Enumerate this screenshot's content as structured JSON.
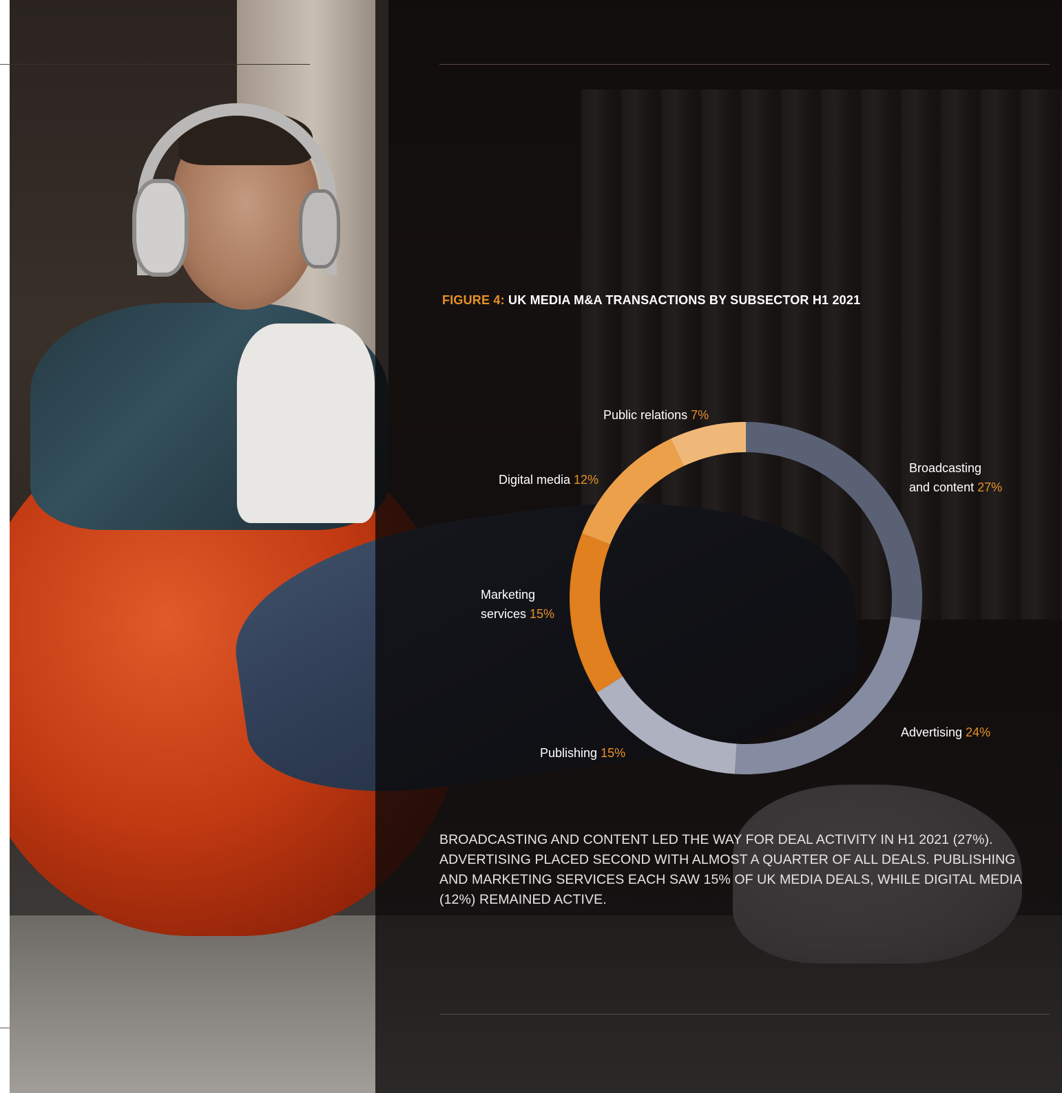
{
  "figure": {
    "prefix": "FIGURE 4:",
    "title": "UK MEDIA M&A TRANSACTIONS BY SUBSECTOR H1 2021"
  },
  "chart_data": {
    "type": "pie",
    "style": "donut",
    "categories": [
      "Broadcasting and content",
      "Advertising",
      "Publishing",
      "Marketing services",
      "Digital media",
      "Public relations"
    ],
    "values": [
      27,
      24,
      15,
      15,
      12,
      7
    ],
    "unit": "%",
    "colors": [
      "#5b6175",
      "#858ba0",
      "#aeb1c0",
      "#e0801e",
      "#eca04a",
      "#f0b878"
    ],
    "labels": [
      {
        "line1": "Broadcasting",
        "line2": "and content",
        "pct": "27%"
      },
      {
        "line1": "",
        "line2": "Advertising",
        "pct": "24%"
      },
      {
        "line1": "",
        "line2": "Publishing",
        "pct": "15%"
      },
      {
        "line1": "Marketing",
        "line2": "services",
        "pct": "15%"
      },
      {
        "line1": "",
        "line2": "Digital media",
        "pct": "12%"
      },
      {
        "line1": "",
        "line2": "Public relations",
        "pct": "7%"
      }
    ]
  },
  "summary": "BROADCASTING AND CONTENT LED THE WAY FOR DEAL ACTIVITY IN H1 2021 (27%). ADVERTISING PLACED SECOND WITH ALMOST A QUARTER OF ALL DEALS. PUBLISHING AND MARKETING SERVICES EACH SAW 15% OF UK MEDIA DEALS, WHILE DIGITAL MEDIA (12%) REMAINED ACTIVE."
}
